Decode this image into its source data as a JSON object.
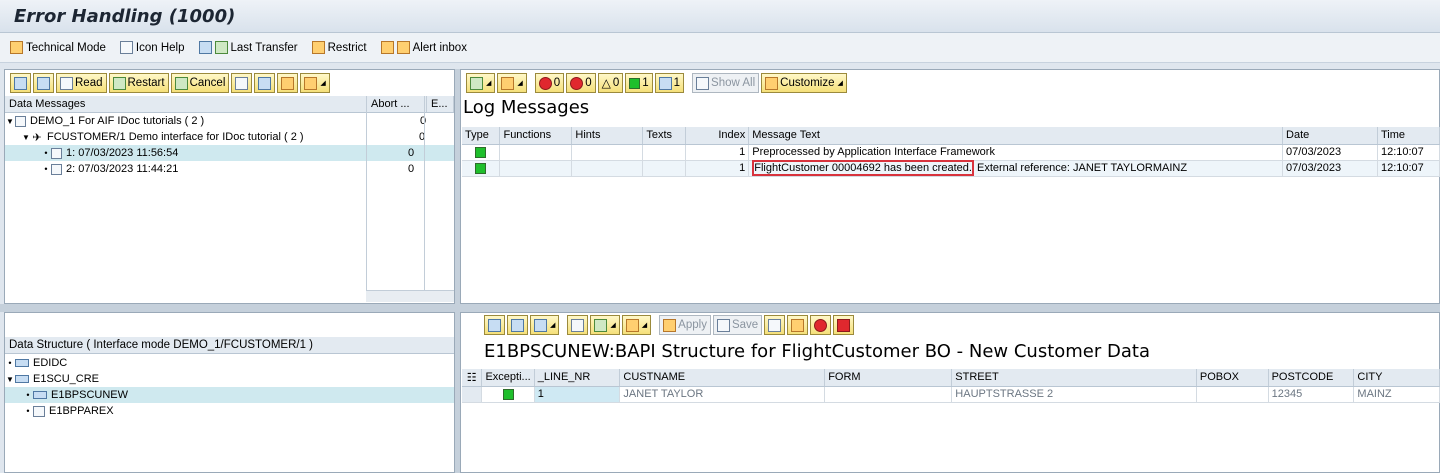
{
  "window": {
    "title": "Error Handling (1000)"
  },
  "app_toolbar": [
    {
      "label": "Technical Mode",
      "icon": "technical-mode-icon"
    },
    {
      "label": "Icon Help",
      "icon": "icon-help-icon"
    },
    {
      "label": "Last Transfer",
      "icon": "last-transfer-icon"
    },
    {
      "label": "Restrict",
      "icon": "restrict-icon"
    },
    {
      "label": "Alert inbox",
      "icon": "alert-inbox-icon"
    }
  ],
  "left_top": {
    "toolbar": {
      "read": "Read",
      "restart": "Restart",
      "cancel": "Cancel"
    },
    "headers": {
      "data_messages": "Data Messages",
      "abort": "Abort ...",
      "e": "E..."
    },
    "rows": [
      {
        "label": "DEMO_1 For AIF IDoc tutorials ( 2 )",
        "count": "0"
      },
      {
        "label": "FCUSTOMER/1 Demo interface for IDoc tutorial ( 2 )",
        "count": "0"
      },
      {
        "label": "1: 07/03/2023 11:56:54",
        "count": "0"
      },
      {
        "label": "2: 07/03/2023 11:44:21",
        "count": "0"
      }
    ]
  },
  "right_top": {
    "toolbar": {
      "counts": [
        "0",
        "0",
        "0",
        "1",
        "1"
      ],
      "show_all": "Show All",
      "customize": "Customize"
    },
    "title": "Log Messages",
    "headers": [
      "Type",
      "Functions",
      "Hints",
      "Texts",
      "Index",
      "Message Text",
      "Date",
      "Time"
    ],
    "rows": [
      {
        "index": "1",
        "text": "Preprocessed by Application Interface Framework",
        "text_extra": "",
        "date": "07/03/2023",
        "time": "12:10:07"
      },
      {
        "index": "1",
        "text": "FlightCustomer 00004692 has been created.",
        "text_extra": " External reference: JANET TAYLORMAINZ",
        "date": "07/03/2023",
        "time": "12:10:07"
      }
    ]
  },
  "left_bottom": {
    "header": "Data Structure ( Interface mode DEMO_1/FCUSTOMER/1 )",
    "rows": [
      "EDIDC",
      "E1SCU_CRE",
      "E1BPSCUNEW",
      "E1BPPAREX"
    ]
  },
  "right_bottom": {
    "toolbar": {
      "apply": "Apply",
      "save": "Save"
    },
    "title": "E1BPSCUNEW:BAPI Structure for FlightCustomer BO - New Customer Data",
    "headers": [
      "Excepti...",
      "_LINE_NR",
      "CUSTNAME",
      "FORM",
      "STREET",
      "POBOX",
      "POSTCODE",
      "CITY"
    ],
    "row": {
      "line_nr": "1",
      "custname": "JANET TAYLOR",
      "form": "",
      "street": "HAUPTSTRASSE 2",
      "pobox": "",
      "postcode": "12345",
      "city": "MAINZ"
    }
  }
}
